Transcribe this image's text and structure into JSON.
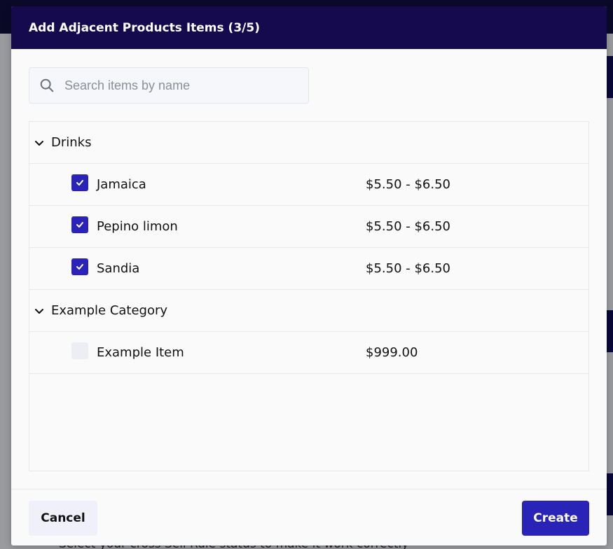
{
  "modal": {
    "title": "Add Adjacent Products Items (3/5)"
  },
  "search": {
    "placeholder": "Search items by name",
    "value": ""
  },
  "categories": [
    {
      "name": "Drinks",
      "expanded": true,
      "items": [
        {
          "name": "Jamaica",
          "price": "$5.50 - $6.50",
          "checked": true
        },
        {
          "name": "Pepino limon",
          "price": "$5.50 - $6.50",
          "checked": true
        },
        {
          "name": "Sandia",
          "price": "$5.50 - $6.50",
          "checked": true
        }
      ]
    },
    {
      "name": "Example Category",
      "expanded": true,
      "items": [
        {
          "name": "Example Item",
          "price": "$999.00",
          "checked": false
        }
      ]
    }
  ],
  "footer": {
    "cancel_label": "Cancel",
    "create_label": "Create"
  },
  "background": {
    "partial_text": "Select your cross Sell Rule status to make it work correctly"
  },
  "icons": {
    "search": "search-icon",
    "chevron": "chevron-down-icon",
    "check": "check-icon"
  },
  "colors": {
    "header_bg": "#140a4d",
    "accent": "#2a23b8",
    "cancel_bg": "#eff0fa"
  }
}
